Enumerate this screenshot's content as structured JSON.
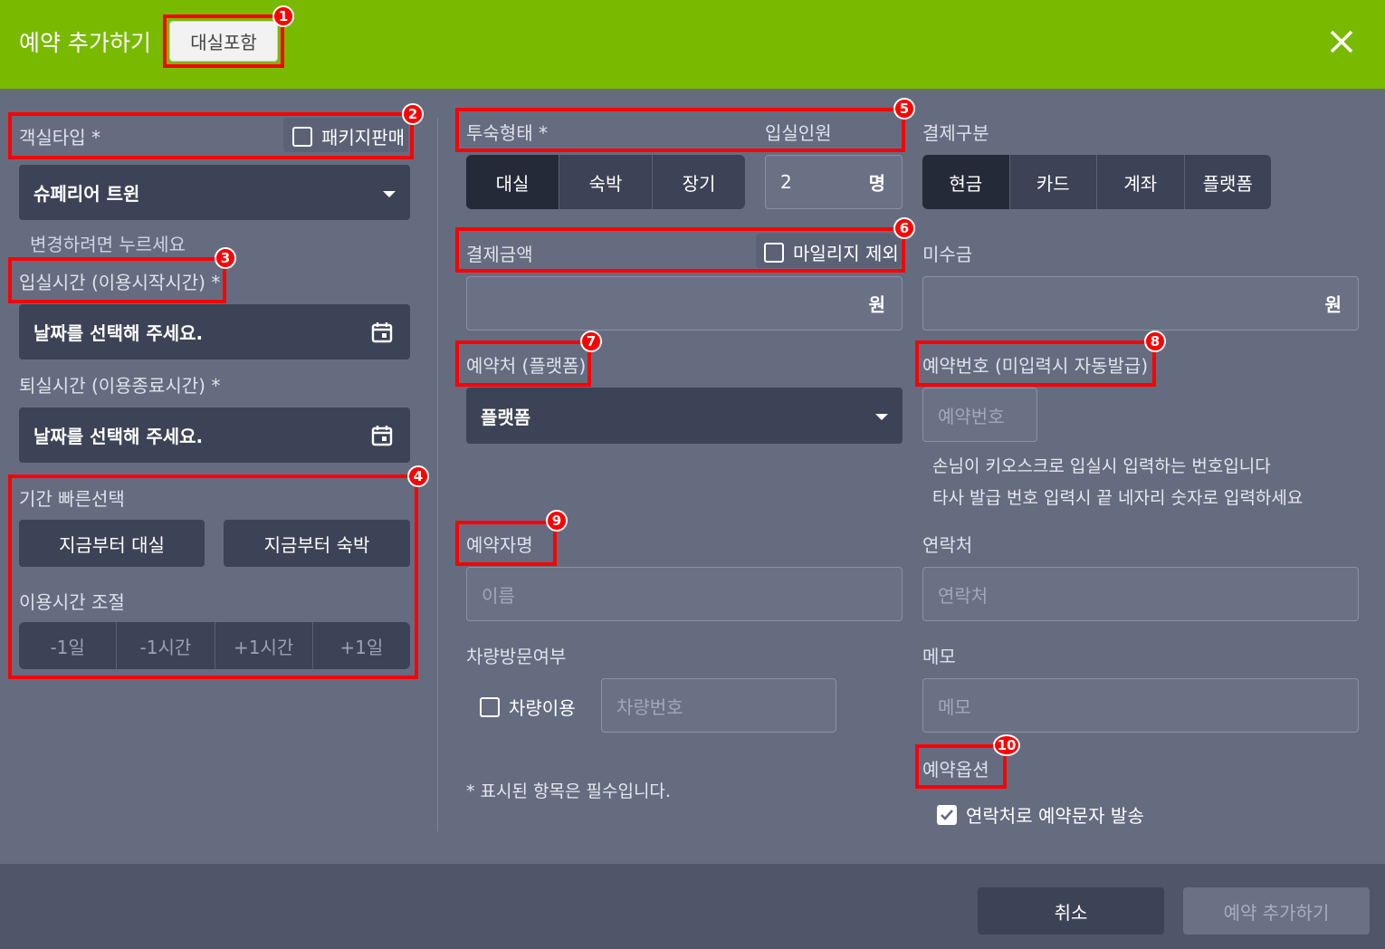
{
  "header": {
    "title": "예약 추가하기",
    "include_room_label": "대실포함"
  },
  "left": {
    "room_type_label": "객실타입 *",
    "package_label": "패키지판매",
    "room_type_value": "슈페리어 트윈",
    "room_type_hint": "변경하려면 누르세요",
    "checkin_label": "입실시간 (이용시작시간) *",
    "checkin_placeholder": "날짜를 선택해 주세요.",
    "checkout_label": "퇴실시간 (이용종료시간) *",
    "checkout_placeholder": "날짜를 선택해 주세요.",
    "quick_label": "기간 빠른선택",
    "quick_rent_label": "지금부터 대실",
    "quick_stay_label": "지금부터 숙박",
    "adjust_label": "이용시간 조절",
    "adjust": [
      "-1일",
      "-1시간",
      "+1시간",
      "+1일"
    ]
  },
  "middle": {
    "stay_type_label": "투숙형태 *",
    "stay_types": [
      "대실",
      "숙박",
      "장기"
    ],
    "guests_label": "입실인원",
    "guests_value": "2",
    "guests_unit": "명",
    "amount_label": "결제금액",
    "mileage_label": "마일리지 제외",
    "amount_unit": "원",
    "source_label": "예약처 (플랫폼)",
    "source_value": "플랫폼",
    "booker_label": "예약자명",
    "booker_placeholder": "이름",
    "vehicle_label": "차량방문여부",
    "vehicle_checkbox_label": "차량이용",
    "vehicle_placeholder": "차량번호",
    "required_note": "* 표시된 항목은 필수입니다."
  },
  "right": {
    "payment_label": "결제구분",
    "payment_types": [
      "현금",
      "카드",
      "계좌",
      "플랫폼"
    ],
    "unpaid_label": "미수금",
    "unpaid_unit": "원",
    "booking_no_label": "예약번호 (미입력시 자동발급)",
    "booking_no_placeholder": "예약번호",
    "booking_note_1": "손님이 키오스크로 입실시 입력하는 번호입니다",
    "booking_note_2": "타사 발급 번호 입력시 끝 네자리 숫자로 입력하세요",
    "contact_label": "연락처",
    "contact_placeholder": "연락처",
    "memo_label": "메모",
    "memo_placeholder": "메모",
    "options_label": "예약옵션",
    "sms_label": "연락처로 예약문자 발송"
  },
  "footer": {
    "cancel_label": "취소",
    "submit_label": "예약 추가하기"
  },
  "annotations": [
    "1",
    "2",
    "3",
    "4",
    "5",
    "6",
    "7",
    "8",
    "9",
    "10"
  ],
  "colors": {
    "header": "#79b900",
    "background": "#656c80",
    "dark_button": "#3d4356",
    "active_segment": "#252a38",
    "annotation": "#ff0000"
  }
}
